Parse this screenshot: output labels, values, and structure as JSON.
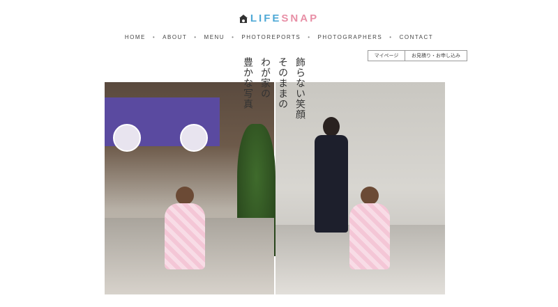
{
  "brand": {
    "name": "LIFESNAP"
  },
  "nav": {
    "items": [
      "HOME",
      "ABOUT",
      "MENU",
      "PHOTOREPORTS",
      "PHOTOGRAPHERS",
      "CONTACT"
    ],
    "separator": "•"
  },
  "header_buttons": {
    "mypage": "マイページ",
    "estimate": "お見積り・お申し込み"
  },
  "hero": {
    "tagline_columns": [
      "飾らない笑顔",
      "そのままの",
      "わが家の",
      "豊かな写真"
    ]
  },
  "colors": {
    "logo_blue": "#4fa9d6",
    "logo_pink": "#e88fa6",
    "nav_text": "#444444"
  }
}
